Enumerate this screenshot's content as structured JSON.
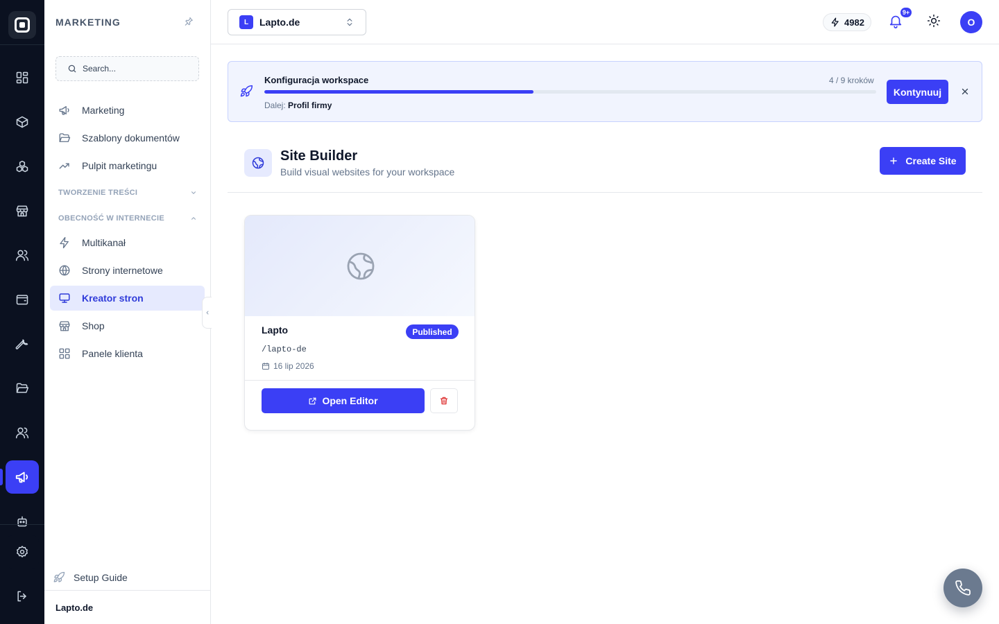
{
  "rail": {
    "items": [
      {
        "icon": "grid-icon"
      },
      {
        "icon": "package-icon"
      },
      {
        "icon": "boxes-icon"
      },
      {
        "icon": "store-icon"
      },
      {
        "icon": "users-icon"
      },
      {
        "icon": "wallet-icon"
      },
      {
        "icon": "wrench-icon"
      },
      {
        "icon": "folder-open-icon"
      },
      {
        "icon": "team-icon"
      },
      {
        "icon": "megaphone-icon",
        "active": true
      }
    ],
    "bottom": [
      {
        "icon": "settings-icon"
      },
      {
        "icon": "logout-icon"
      }
    ]
  },
  "sidebar": {
    "title": "MARKETING",
    "search_placeholder": "Search...",
    "items_top": [
      {
        "label": "Marketing",
        "icon": "megaphone-icon"
      },
      {
        "label": "Szablony dokumentów",
        "icon": "folder-icon"
      },
      {
        "label": "Pulpit marketingu",
        "icon": "trending-up-icon"
      }
    ],
    "section_content": "TWORZENIE TREŚCI",
    "section_online": "OBECNOŚĆ W INTERNECIE",
    "items_online": [
      {
        "label": "Multikanał",
        "icon": "zap-icon"
      },
      {
        "label": "Strony internetowe",
        "icon": "globe-icon"
      },
      {
        "label": "Kreator stron",
        "icon": "monitor-icon",
        "active": true
      },
      {
        "label": "Shop",
        "icon": "store-icon"
      },
      {
        "label": "Panele klienta",
        "icon": "grid-icon"
      }
    ],
    "setup_guide": "Setup Guide",
    "footer_workspace": "Lapto.de"
  },
  "header": {
    "workspace_initial": "L",
    "workspace_name": "Lapto.de",
    "credits": "4982",
    "notifications_badge": "9+",
    "avatar_initial": "O"
  },
  "onboarding": {
    "title": "Konfiguracja workspace",
    "steps_text": "4 / 9 kroków",
    "progress_fraction": 0.44,
    "next_label": "Dalej:",
    "next_step": "Profil firmy",
    "continue_label": "Kontynuuj"
  },
  "page": {
    "title": "Site Builder",
    "subtitle": "Build visual websites for your workspace",
    "create_label": "Create Site"
  },
  "sites": [
    {
      "name": "Lapto",
      "status": "Published",
      "slug": "/lapto-de",
      "date": "16 lip 2026",
      "open_label": "Open Editor"
    }
  ],
  "colors": {
    "accent": "#3b3ff5",
    "rail_bg": "#0b1120",
    "danger": "#dc2626"
  }
}
